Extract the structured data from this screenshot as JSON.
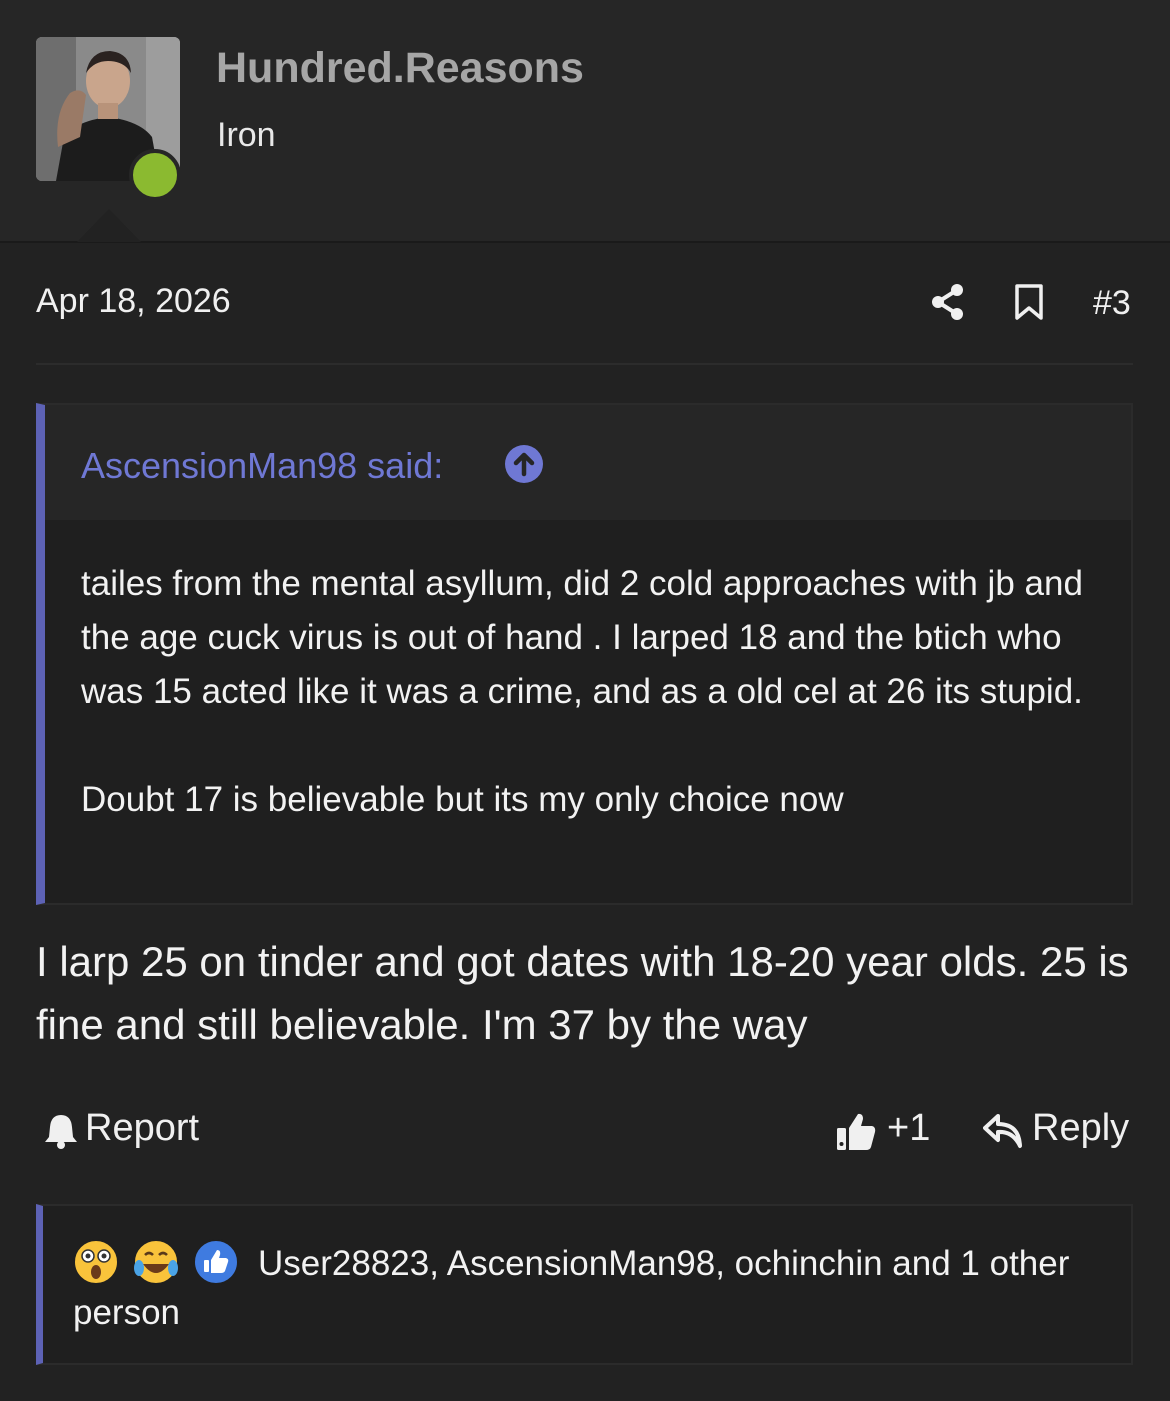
{
  "user": {
    "name": "Hundred.Reasons",
    "rank": "Iron",
    "status_color": "#8bba30"
  },
  "post": {
    "date": "Apr 18, 2026",
    "number": "#3",
    "quote": {
      "author_label": "AscensionMan98 said:",
      "paragraphs": [
        "tailes from the mental asyllum, did 2 cold approaches with jb and the age cuck virus is out of hand . I larped 18 and the btich who was 15 acted like it was a crime, and as a old cel at 26 its stupid.",
        "Doubt 17 is believable but its my only choice now"
      ]
    },
    "message": "I larp 25 on tinder and got dates with 18-20 year olds. 25 is fine and still believable. I'm 37 by the way"
  },
  "actions": {
    "report_label": "Report",
    "like_count": "+1",
    "reply_label": "Reply"
  },
  "reactions": {
    "icons": [
      "astonished-emoji",
      "joy-tears-emoji",
      "like-icon"
    ],
    "text": "User28823, AscensionMan98, ochinchin and 1 other person"
  },
  "colors": {
    "accent": "#5d62b5",
    "link": "#6f78d4",
    "background": "#222222"
  }
}
